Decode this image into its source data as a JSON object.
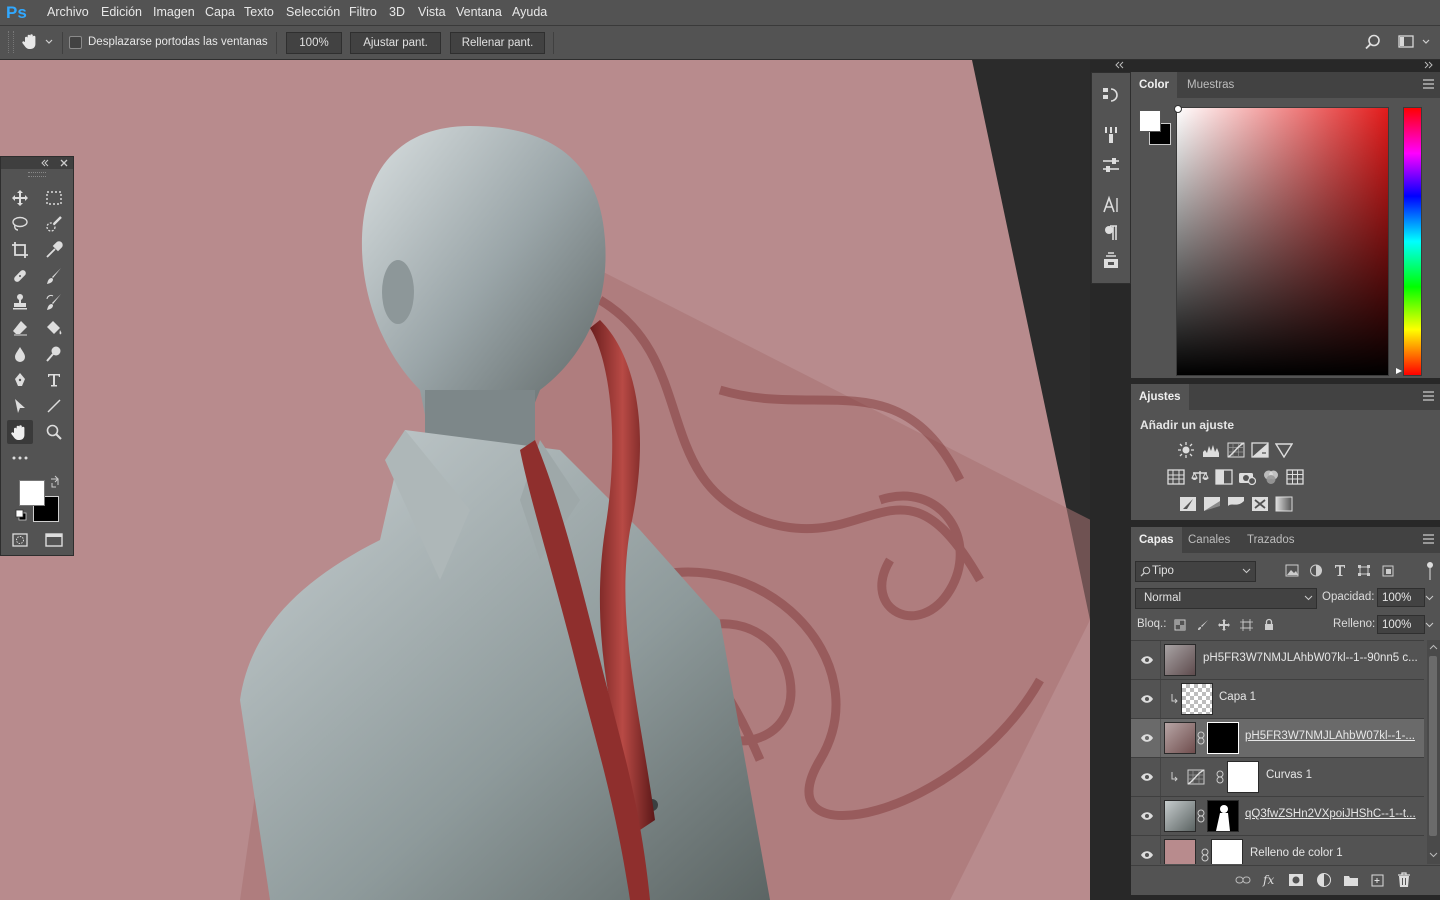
{
  "app": {
    "logo": "Ps"
  },
  "menu": [
    "Archivo",
    "Edición",
    "Imagen",
    "Capa",
    "Texto",
    "Selección",
    "Filtro",
    "3D",
    "Vista",
    "Ventana",
    "Ayuda"
  ],
  "options": {
    "tool_icon": "hand-icon",
    "scroll_all_label": "Desplazarse portodas las ventanas",
    "scroll_all_checked": false,
    "zoom_value": "100%",
    "fit_screen_label": "Ajustar pant.",
    "fill_screen_label": "Rellenar pant."
  },
  "tools": [
    "move",
    "marquee",
    "lasso",
    "quick-select",
    "crop",
    "eyedropper",
    "healing",
    "brush",
    "stamp",
    "history-brush",
    "eraser",
    "paint-bucket",
    "blur",
    "dodge",
    "pen",
    "type",
    "path-select",
    "line",
    "hand",
    "zoom",
    "more"
  ],
  "colors": {
    "foreground": "#ffffff",
    "background": "#000000",
    "canvas_bg": "#b88b8d"
  },
  "color_panel": {
    "tabs": [
      "Color",
      "Muestras"
    ],
    "active_tab": "Color"
  },
  "adjustments_panel": {
    "tab": "Ajustes",
    "heading": "Añadir un ajuste",
    "icons_row1": [
      "brightness-icon",
      "levels-icon",
      "curves-icon",
      "exposure-icon",
      "vibrance-icon"
    ],
    "icons_row2": [
      "hue-sat-icon",
      "color-balance-icon",
      "black-white-icon",
      "photo-filter-icon",
      "channel-mixer-icon",
      "color-lookup-icon"
    ],
    "icons_row3": [
      "invert-icon",
      "posterize-icon",
      "threshold-icon",
      "selective-color-icon",
      "gradient-map-icon"
    ]
  },
  "layers_panel": {
    "tabs": [
      "Capas",
      "Canales",
      "Trazados"
    ],
    "active_tab": "Capas",
    "filter_label": "Tipo",
    "blend_mode": "Normal",
    "opacity_label": "Opacidad:",
    "opacity_value": "100%",
    "lock_label": "Bloq.:",
    "fill_label": "Relleno:",
    "fill_value": "100%",
    "layers": [
      {
        "name": "pH5FR3W7NMJLAhbW07kl--1--90nn5 c...",
        "clipped": false,
        "mask": false,
        "selected": false,
        "thumb": "photo"
      },
      {
        "name": "Capa 1",
        "clipped": true,
        "mask": false,
        "selected": false,
        "thumb": "transparent"
      },
      {
        "name": "pH5FR3W7NMJLAhbW07kl--1-...",
        "clipped": false,
        "mask": true,
        "selected": true,
        "thumb": "photo",
        "mask_type": "black"
      },
      {
        "name": "Curvas 1",
        "clipped": true,
        "mask": true,
        "selected": false,
        "thumb": "curves",
        "mask_type": "white"
      },
      {
        "name": "qQ3fwZSHn2VXpoiJHShC--1--t...",
        "clipped": false,
        "mask": true,
        "selected": false,
        "thumb": "photo",
        "mask_type": "silhouette"
      },
      {
        "name": "Relleno de color 1",
        "clipped": false,
        "mask": true,
        "selected": false,
        "thumb": "fill",
        "mask_type": "white"
      }
    ]
  }
}
